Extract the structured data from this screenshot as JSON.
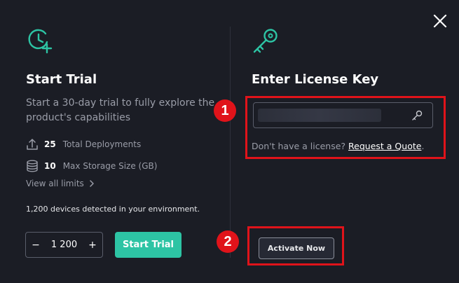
{
  "close": {
    "icon": "close-icon"
  },
  "trial": {
    "icon": "clock-plus-icon",
    "title": "Start Trial",
    "description": "Start a 30-day trial to fully explore the product's capabilities",
    "stats": [
      {
        "icon": "upload-icon",
        "value": "25",
        "label": "Total Deployments"
      },
      {
        "icon": "database-icon",
        "value": "10",
        "label": "Max Storage Size (GB)"
      }
    ],
    "view_limits": "View all limits",
    "devices_text": "1,200 devices detected in your environment.",
    "stepper": {
      "minus": "−",
      "value": "1 200",
      "plus": "+"
    },
    "start_button": "Start Trial"
  },
  "license": {
    "icon": "key-icon",
    "title": "Enter License Key",
    "input_icon": "key-icon",
    "no_license_text": "Don't have a license?",
    "request_link": "Request a Quote",
    "period": ".",
    "activate_button": "Activate Now"
  },
  "annotations": {
    "callout_1": "1",
    "callout_2": "2",
    "highlight_color": "#e0131a"
  },
  "colors": {
    "background": "#1b1d25",
    "accent": "#2dc4a4",
    "muted_text": "#9a9da8"
  }
}
